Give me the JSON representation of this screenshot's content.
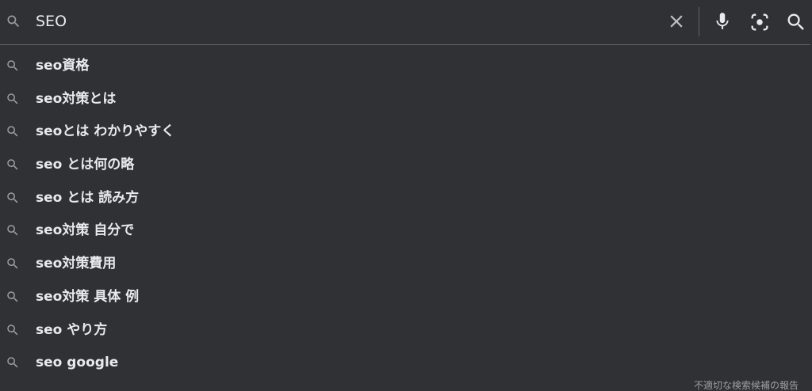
{
  "search": {
    "query": "SEO",
    "icons": {
      "search_left": "search-icon",
      "clear": "close-icon",
      "voice": "microphone-icon",
      "lens": "camera-lens-icon",
      "submit": "search-icon"
    }
  },
  "suggestions": [
    {
      "text": "seo資格",
      "icon": "search-icon"
    },
    {
      "text": "seo対策とは",
      "icon": "search-icon"
    },
    {
      "text": "seoとは わかりやすく",
      "icon": "search-icon"
    },
    {
      "text": "seo とは何の略",
      "icon": "search-icon"
    },
    {
      "text": "seo とは 読み方",
      "icon": "search-icon"
    },
    {
      "text": "seo対策 自分で",
      "icon": "search-icon"
    },
    {
      "text": "seo対策費用",
      "icon": "search-icon"
    },
    {
      "text": "seo対策 具体 例",
      "icon": "search-icon"
    },
    {
      "text": "seo やり方",
      "icon": "search-icon"
    },
    {
      "text": "seo google",
      "icon": "search-icon"
    }
  ],
  "footer": {
    "report_link": "不適切な検索候補の報告"
  },
  "colors": {
    "background": "#303134",
    "text": "#e8eaed",
    "icon": "#9aa0a6",
    "divider": "#5f6368"
  }
}
